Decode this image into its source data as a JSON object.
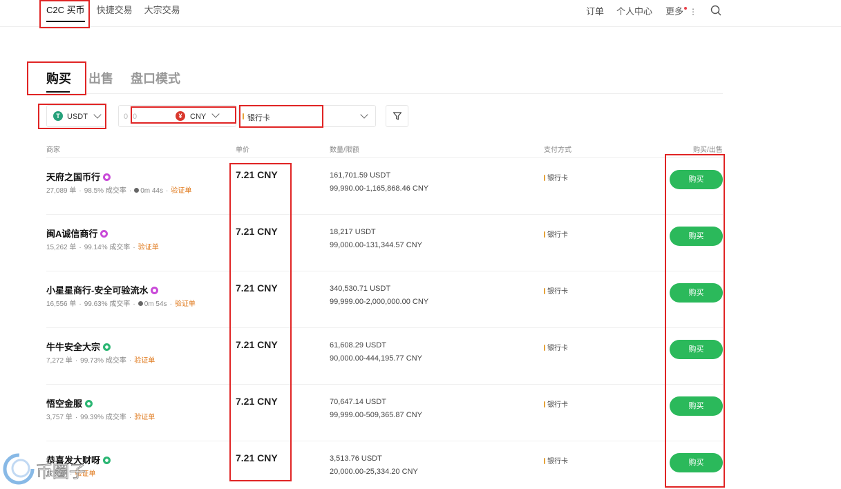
{
  "topnav": {
    "left_items": [
      "C2C 买币",
      "快捷交易",
      "大宗交易"
    ],
    "active_index": 0,
    "orders": "订单",
    "personal_center": "个人中心",
    "more": "更多"
  },
  "tabs": [
    "购买",
    "出售",
    "盘口模式"
  ],
  "filters": {
    "coin": "USDT",
    "amount_value": "0",
    "currency": "CNY",
    "payment": "银行卡"
  },
  "table": {
    "headers": {
      "merchant": "商家",
      "price": "单价",
      "quantity": "数量/限额",
      "payment": "支付方式",
      "action": "购买/出售"
    },
    "rows": [
      {
        "name": "天府之国币行",
        "badge": "purple",
        "orders": "27,089 单",
        "rate": "98.5% 成交率",
        "time": "0m 44s",
        "verify": "验证单",
        "price": "7.21 CNY",
        "qty": "161,701.59 USDT",
        "limit": "99,990.00-1,165,868.46 CNY",
        "payment": "银行卡",
        "button": "购买"
      },
      {
        "name": "闽A诚信商行",
        "badge": "purple",
        "orders": "15,262 单",
        "rate": "99.14% 成交率",
        "time": "",
        "verify": "验证单",
        "price": "7.21 CNY",
        "qty": "18,217 USDT",
        "limit": "99,000.00-131,344.57 CNY",
        "payment": "银行卡",
        "button": "购买"
      },
      {
        "name": "小星星商行-安全可验流水",
        "badge": "purple",
        "orders": "16,556 单",
        "rate": "99.63% 成交率",
        "time": "0m 54s",
        "verify": "验证单",
        "price": "7.21 CNY",
        "qty": "340,530.71 USDT",
        "limit": "99,999.00-2,000,000.00 CNY",
        "payment": "银行卡",
        "button": "购买"
      },
      {
        "name": "牛牛安全大宗",
        "badge": "green",
        "orders": "7,272 单",
        "rate": "99.73% 成交率",
        "time": "",
        "verify": "验证单",
        "price": "7.21 CNY",
        "qty": "61,608.29 USDT",
        "limit": "90,000.00-444,195.77 CNY",
        "payment": "银行卡",
        "button": "购买"
      },
      {
        "name": "悟空金服",
        "badge": "green",
        "orders": "3,757 单",
        "rate": "99.39% 成交率",
        "time": "",
        "verify": "验证单",
        "price": "7.21 CNY",
        "qty": "70,647.14 USDT",
        "limit": "99,999.00-509,365.87 CNY",
        "payment": "银行卡",
        "button": "购买"
      },
      {
        "name": "恭喜发大财呀",
        "badge": "green",
        "orders": "",
        "rate": "成交率",
        "time": "",
        "verify": "验证单",
        "price": "7.21 CNY",
        "qty": "3,513.76 USDT",
        "limit": "20,000.00-25,334.20 CNY",
        "payment": "银行卡",
        "button": "购买"
      }
    ]
  },
  "watermark": "币圈子",
  "colors": {
    "buy_button": "#2bb95b",
    "annotation_red": "#e02424",
    "verify_orange": "#e07b1f",
    "usdt_green": "#26a17b",
    "cny_red": "#d9382d"
  }
}
